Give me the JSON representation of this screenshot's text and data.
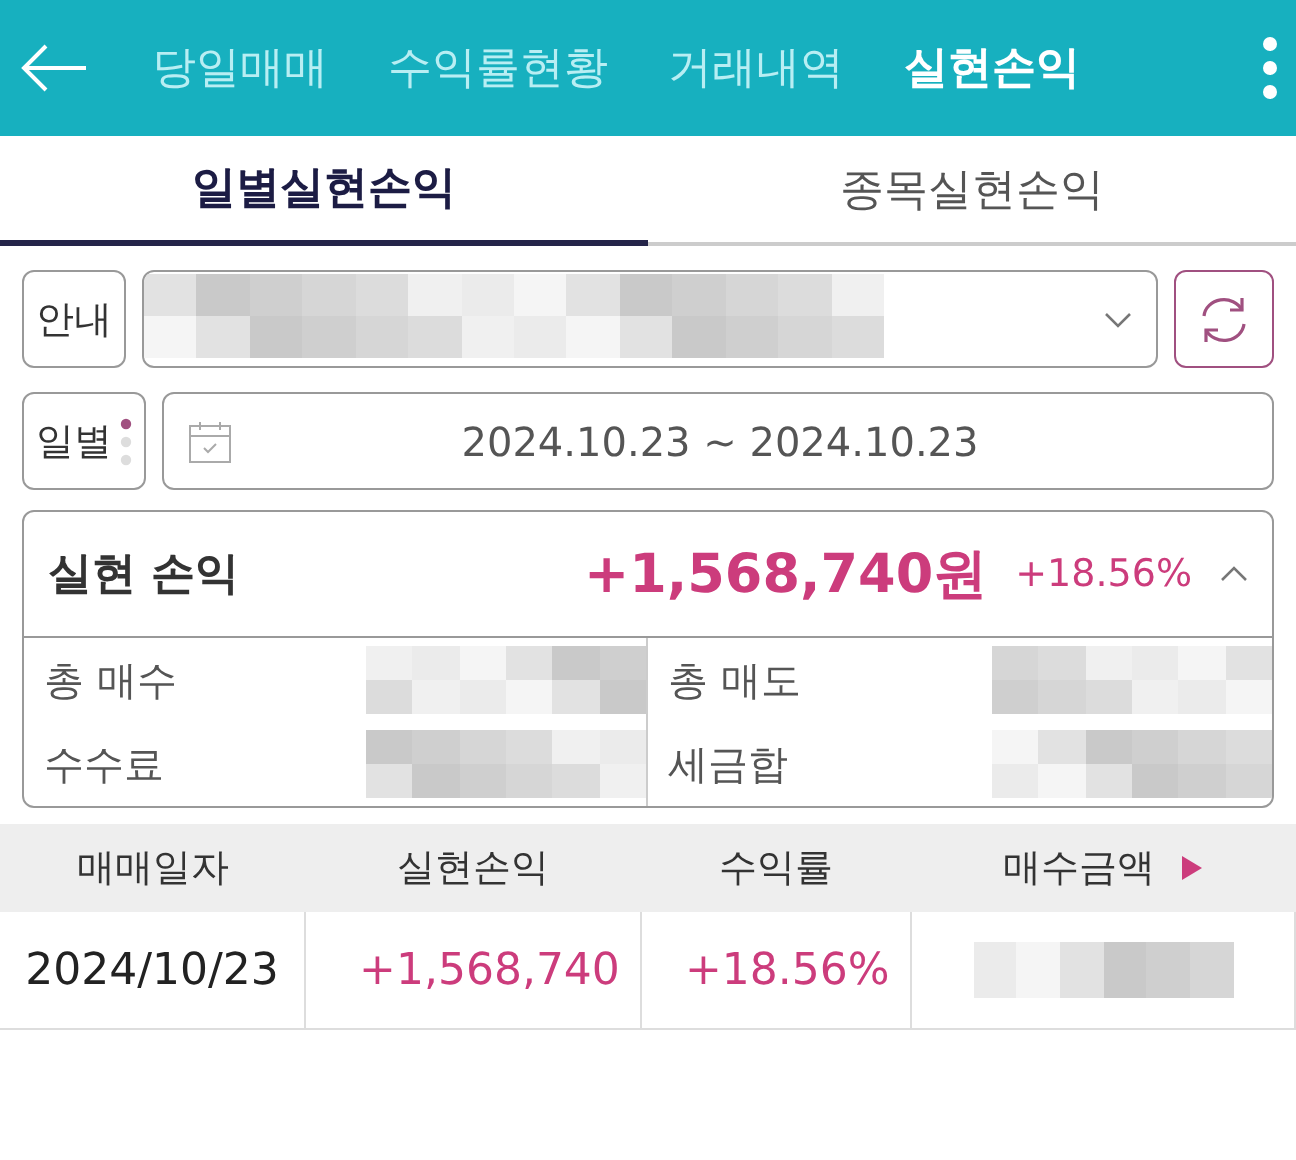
{
  "top_tabs": [
    {
      "label": "당일매매",
      "selected": false
    },
    {
      "label": "수익률현황",
      "selected": false
    },
    {
      "label": "거래내역",
      "selected": false
    },
    {
      "label": "실현손익",
      "selected": true
    }
  ],
  "sub_tabs": [
    {
      "label": "일별실현손익",
      "selected": true
    },
    {
      "label": "종목실현손익",
      "selected": false
    }
  ],
  "info_button": "안내",
  "period_button": "일별",
  "date_range": "2024.10.23 ~ 2024.10.23",
  "summary": {
    "title": "실현 손익",
    "amount": "+1,568,740원",
    "rate": "+18.56%",
    "expanded": true,
    "items": [
      {
        "label": "총 매수"
      },
      {
        "label": "총 매도"
      },
      {
        "label": "수수료"
      },
      {
        "label": "세금합"
      }
    ]
  },
  "table": {
    "columns": [
      "매매일자",
      "실현손익",
      "수익률",
      "매수금액"
    ],
    "rows": [
      {
        "date": "2024/10/23",
        "profit": "+1,568,740",
        "rate": "+18.56%"
      }
    ]
  }
}
